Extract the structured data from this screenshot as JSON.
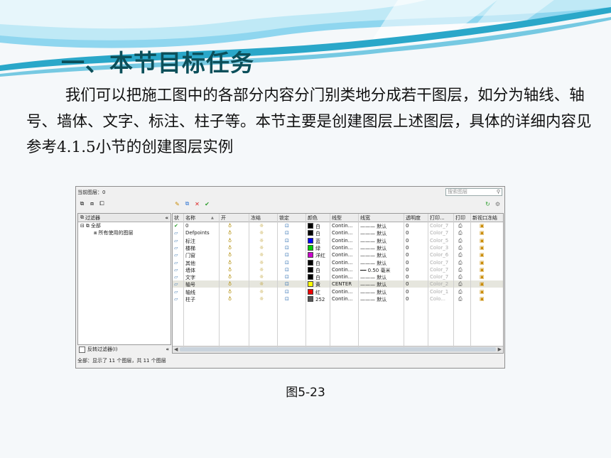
{
  "slide": {
    "title": "一、本节目标任务",
    "paragraph": "        我们可以把施工图中的各部分内容分门别类地分成若干图层，如分为轴线、轴号、墙体、文字、标注、柱子等。本节主要是创建图层上述图层，具体的详细内容见参考4.1.5小节的创建图层实例",
    "caption": "图5-23"
  },
  "layer_manager": {
    "current_layer": "当前图层：0",
    "search_placeholder": "搜索图层",
    "filters_header": "过滤器",
    "tree": {
      "root": "全部",
      "child": "所有使用的图层"
    },
    "invert_filter": "反转过滤器(I)",
    "status": "全部：显示了 11 个图层，共 11 个图层",
    "columns": [
      "状",
      "名称",
      "开",
      "冻结",
      "锁定",
      "颜色",
      "线型",
      "线宽",
      "透明度",
      "打印...",
      "打印",
      "新视口冻结"
    ],
    "rows": [
      {
        "name": "0",
        "color_hex": "#000000",
        "color": "白",
        "linetype": "Contin...",
        "lineweight": "——— 默认",
        "transparency": "0",
        "plot_style": "Color_7",
        "current": true
      },
      {
        "name": "Defpoints",
        "color_hex": "#000000",
        "color": "白",
        "linetype": "Contin...",
        "lineweight": "——— 默认",
        "transparency": "0",
        "plot_style": "Color_7"
      },
      {
        "name": "标注",
        "color_hex": "#0000ff",
        "color": "蓝",
        "linetype": "Contin...",
        "lineweight": "——— 默认",
        "transparency": "0",
        "plot_style": "Color_5"
      },
      {
        "name": "楼梯",
        "color_hex": "#00cc00",
        "color": "绿",
        "linetype": "Contin...",
        "lineweight": "——— 默认",
        "transparency": "0",
        "plot_style": "Color_3"
      },
      {
        "name": "门窗",
        "color_hex": "#cc00cc",
        "color": "洋红",
        "linetype": "Contin...",
        "lineweight": "——— 默认",
        "transparency": "0",
        "plot_style": "Color_6"
      },
      {
        "name": "其他",
        "color_hex": "#000000",
        "color": "白",
        "linetype": "Contin...",
        "lineweight": "——— 默认",
        "transparency": "0",
        "plot_style": "Color_7"
      },
      {
        "name": "墙体",
        "color_hex": "#000000",
        "color": "白",
        "linetype": "Contin...",
        "lineweight": "━━ 0.50 毫米",
        "transparency": "0",
        "plot_style": "Color_7"
      },
      {
        "name": "文字",
        "color_hex": "#000000",
        "color": "白",
        "linetype": "Contin...",
        "lineweight": "——— 默认",
        "transparency": "0",
        "plot_style": "Color_7"
      },
      {
        "name": "轴号",
        "color_hex": "#ffff00",
        "color": "黄",
        "linetype": "CENTER",
        "lineweight": "——— 默认",
        "transparency": "0",
        "plot_style": "Color_2",
        "selected": true
      },
      {
        "name": "轴线",
        "color_hex": "#ee0000",
        "color": "红",
        "linetype": "Contin...",
        "lineweight": "——— 默认",
        "transparency": "0",
        "plot_style": "Color_1"
      },
      {
        "name": "柱子",
        "color_hex": "#555555",
        "color": "252",
        "linetype": "Contin...",
        "lineweight": "——— 默认",
        "transparency": "0",
        "plot_style": "Colo..."
      }
    ]
  }
}
